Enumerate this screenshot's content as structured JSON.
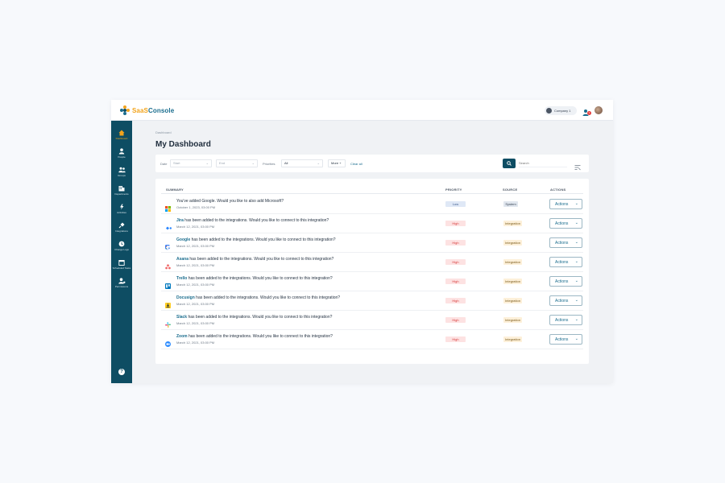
{
  "brand": {
    "name_part1": "SaaS",
    "name_part2": "Console"
  },
  "header": {
    "company_label": "Company 1",
    "notification_count": "1"
  },
  "sidebar": {
    "items": [
      {
        "label": "Dashboard",
        "icon": "home-icon",
        "active": true
      },
      {
        "label": "People",
        "icon": "person-icon"
      },
      {
        "label": "Groups",
        "icon": "group-icon"
      },
      {
        "label": "Departments",
        "icon": "building-icon"
      },
      {
        "label": "Activities",
        "icon": "activity-icon"
      },
      {
        "label": "Integrations",
        "icon": "plug-icon"
      },
      {
        "label": "Change Logs",
        "icon": "history-icon"
      },
      {
        "label": "Scheduled Tasks",
        "icon": "calendar-icon"
      },
      {
        "label": "Permissions",
        "icon": "permission-icon"
      }
    ],
    "help_label": "?"
  },
  "breadcrumb": "Dashboard",
  "page_title": "My Dashboard",
  "filters": {
    "date_label": "Date",
    "start_placeholder": "Start",
    "end_placeholder": "End",
    "priorities_label": "Priorities",
    "priorities_value": "All",
    "more_label": "More +",
    "clear_all_label": "Clear all",
    "search_placeholder": "Search"
  },
  "table": {
    "headers": {
      "summary": "SUMMARY",
      "priority": "PRIORITY",
      "source": "SOURCE",
      "actions": "ACTIONS"
    },
    "rows": [
      {
        "icon": "microsoft-logo",
        "app": "",
        "message": "You've added Google. Would you like to also add Microsoft?",
        "date": "October 1, 2023, 03:00 PM",
        "priority": "Low",
        "source": "System",
        "action": "Actions"
      },
      {
        "icon": "jira-logo",
        "app": "Jira",
        "message": " has been added to the integrations. Would you like to connect to this integration?",
        "date": "March 12, 2021, 03:00 PM",
        "priority": "High",
        "source": "Integration",
        "action": "Actions"
      },
      {
        "icon": "google-logo",
        "app": "Google",
        "message": " has been added to the integrations. Would you like to connect to this integration?",
        "date": "March 12, 2021, 03:00 PM",
        "priority": "High",
        "source": "Integration",
        "action": "Actions"
      },
      {
        "icon": "asana-logo",
        "app": "Asana",
        "message": " has been added to the integrations. Would you like to connect to this integration?",
        "date": "March 12, 2021, 03:00 PM",
        "priority": "High",
        "source": "Integration",
        "action": "Actions"
      },
      {
        "icon": "trello-logo",
        "app": "Trello",
        "message": " has been added to the integrations. Would you like to connect to this integration?",
        "date": "March 12, 2021, 03:00 PM",
        "priority": "High",
        "source": "Integration",
        "action": "Actions"
      },
      {
        "icon": "docusign-logo",
        "app": "Docusign",
        "message": " has been added to the integrations. Would you like to connect to this integration?",
        "date": "March 12, 2021, 03:00 PM",
        "priority": "High",
        "source": "Integration",
        "action": "Actions"
      },
      {
        "icon": "slack-logo",
        "app": "Slack",
        "message": " has been added to the integrations. Would you like to connect to this integration?",
        "date": "March 12, 2021, 03:00 PM",
        "priority": "High",
        "source": "Integration",
        "action": "Actions"
      },
      {
        "icon": "zoom-logo",
        "app": "Zoom",
        "message": " has been added to the integrations. Would you like to connect to this integration?",
        "date": "March 12, 2021, 03:00 PM",
        "priority": "High",
        "source": "Integration",
        "action": "Actions"
      }
    ]
  },
  "colors": {
    "sidebar": "#0e4d63",
    "accent": "#f2a31b",
    "link": "#1a6d8e",
    "high": "#d63b3b"
  }
}
